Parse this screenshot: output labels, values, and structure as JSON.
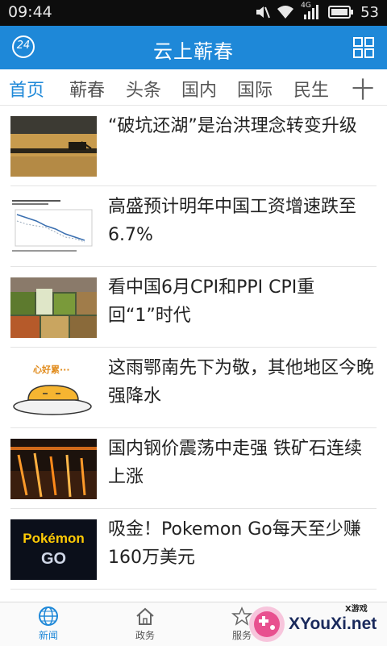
{
  "status": {
    "time": "09:44",
    "battery": "53",
    "network": "4G"
  },
  "header": {
    "title": "云上蕲春",
    "weather_badge": "24"
  },
  "tabs": [
    "首页",
    "蕲春",
    "头条",
    "国内",
    "国际",
    "民生"
  ],
  "tab_add": "十",
  "news": [
    {
      "title": "“破坑还湖”是治洪理念转变升级"
    },
    {
      "title": "高盛预计明年中国工资增速跌至6.7%"
    },
    {
      "title": "看中国6月CPI和PPI  CPI重回“1”时代"
    },
    {
      "title": "这雨鄂南先下为敬，其他地区今晚强降水"
    },
    {
      "title": "国内钢价震荡中走强 铁矿石连续上涨"
    },
    {
      "title": "吸金！Pokemon Go每天至少赚160万美元"
    }
  ],
  "thumb_text": {
    "gudetama": "心好累···",
    "pokemon_top": "Pokémon",
    "pokemon_bottom": "GO"
  },
  "bottom_nav": [
    {
      "label": "新闻",
      "icon": "globe-icon"
    },
    {
      "label": "政务",
      "icon": "home-icon"
    },
    {
      "label": "服务",
      "icon": "star-icon"
    }
  ],
  "watermark": {
    "brand": "XYouXi.net",
    "small": "X游戏"
  },
  "colors": {
    "primary": "#1e88d8",
    "status_bar": "#0d0d0d"
  }
}
